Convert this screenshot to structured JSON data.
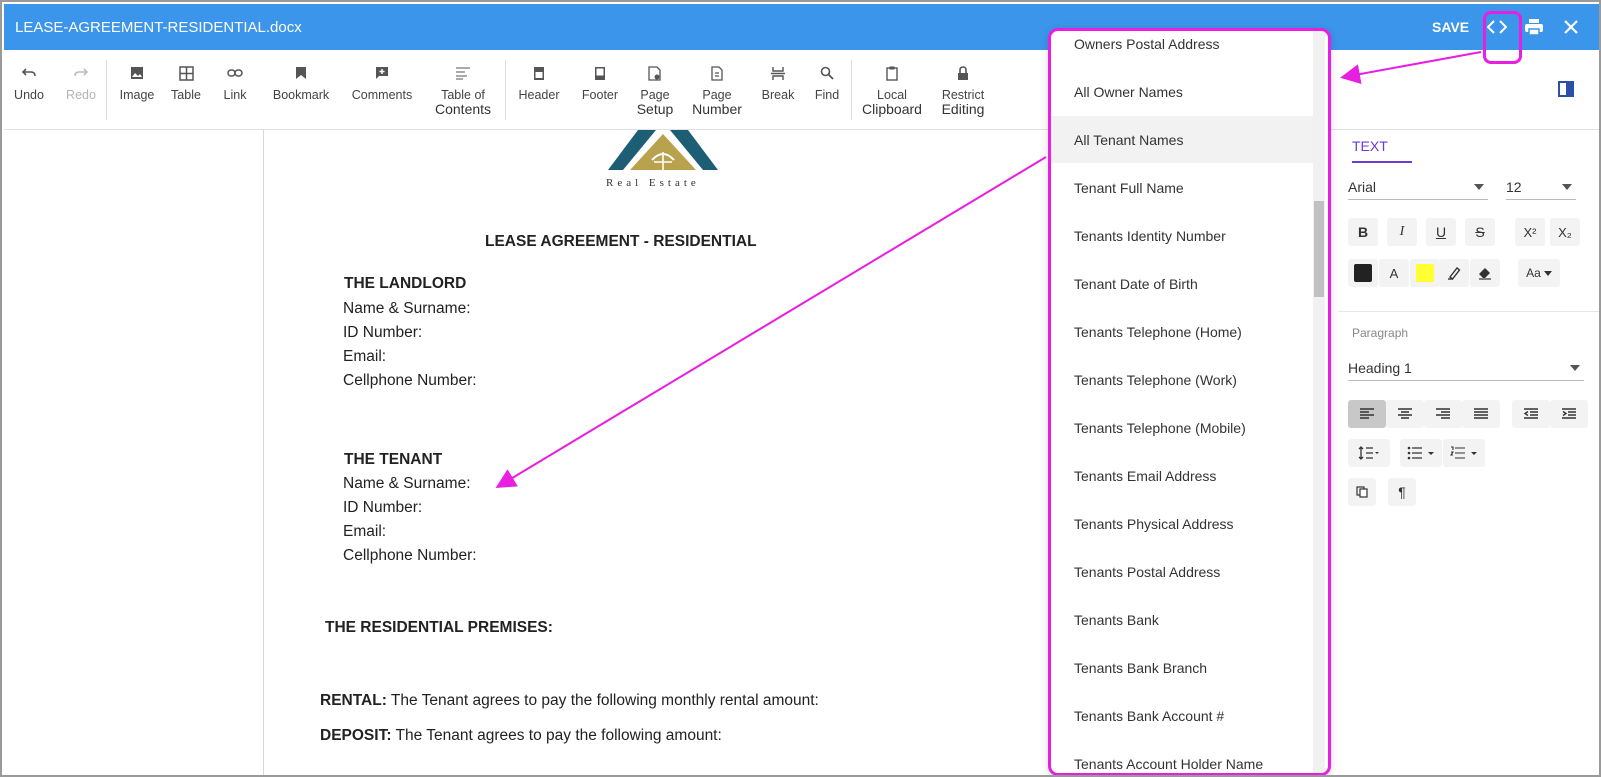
{
  "window": {
    "title": "LEASE-AGREEMENT-RESIDENTIAL.docx",
    "save_label": "SAVE"
  },
  "toolbar": {
    "undo": "Undo",
    "redo": "Redo",
    "image": "Image",
    "table": "Table",
    "link": "Link",
    "bookmark": "Bookmark",
    "comments": "Comments",
    "toc_line1": "Table of",
    "toc_line2": "Contents",
    "header": "Header",
    "footer": "Footer",
    "page_setup_line1": "Page",
    "page_setup_line2": "Setup",
    "page_number_line1": "Page",
    "page_number_line2": "Number",
    "break": "Break",
    "find": "Find",
    "clipboard_line1": "Local",
    "clipboard_line2": "Clipboard",
    "restrict_line1": "Restrict",
    "restrict_line2": "Editing"
  },
  "document": {
    "logo_text": "Real Estate",
    "heading": "LEASE AGREEMENT - RESIDENTIAL",
    "landlord": {
      "title": "THE LANDLORD",
      "name": "Name & Surname:",
      "id": "ID Number:",
      "email": "Email:",
      "cell": "Cellphone Number:"
    },
    "tenant": {
      "title": "THE TENANT",
      "name": "Name & Surname:",
      "id": "ID Number:",
      "email": "Email:",
      "cell": "Cellphone Number:"
    },
    "premises": "THE RESIDENTIAL PREMISES:",
    "rental_label": "RENTAL:",
    "rental_text": " The Tenant agrees to pay the following monthly rental amount:",
    "deposit_label": "DEPOSIT:",
    "deposit_text": " The Tenant agrees to pay the following amount:"
  },
  "dropdown": {
    "items": [
      "Owners Postal Address",
      "All Owner Names",
      "All Tenant Names",
      "Tenant Full Name",
      "Tenants Identity Number",
      "Tenant Date of Birth",
      "Tenants Telephone (Home)",
      "Tenants Telephone (Work)",
      "Tenants Telephone (Mobile)",
      "Tenants Email Address",
      "Tenants Physical Address",
      "Tenants Postal Address",
      "Tenants Bank",
      "Tenants Bank Branch",
      "Tenants Bank Account #",
      "Tenants Account Holder Name"
    ],
    "highlighted": "All Tenant Names"
  },
  "right_panel": {
    "tab": "TEXT",
    "font": "Arial",
    "size": "12",
    "bold": "B",
    "italic": "I",
    "underline": "U",
    "strike": "S",
    "superscript": "X²",
    "subscript": "X₂",
    "font_color_letter": "A",
    "case_label": "Aa",
    "paragraph_label": "Paragraph",
    "paragraph_style": "Heading 1",
    "pilcrow": "¶"
  },
  "colors": {
    "titlebar": "#3b95ea",
    "annotation": "#e81fe0",
    "accent": "#6b3bd4",
    "highlight": "#ffff33"
  }
}
